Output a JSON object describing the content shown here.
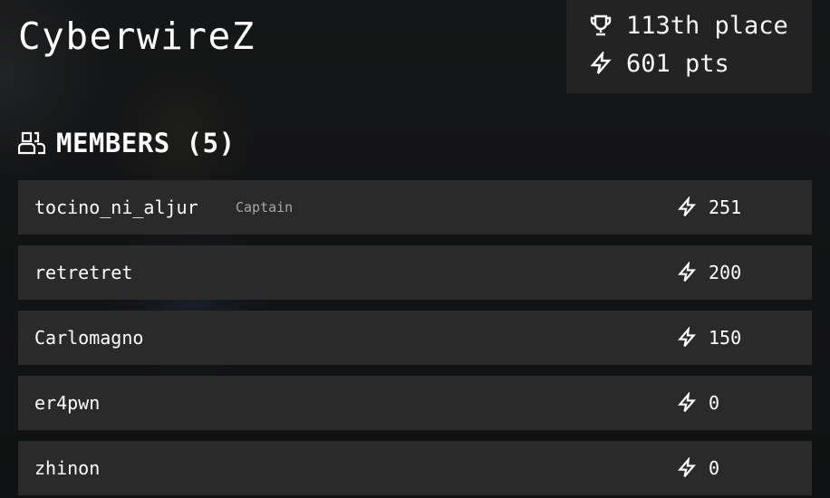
{
  "team": {
    "name": "CyberwireZ"
  },
  "stats": {
    "place": "113th place",
    "place_icon": "trophy-icon",
    "points": "601 pts",
    "points_icon": "lightning-icon"
  },
  "members": {
    "heading": "MEMBERS (5)",
    "heading_icon": "users-icon",
    "list": [
      {
        "name": "tocino_ni_aljur",
        "role": "Captain",
        "score": "251"
      },
      {
        "name": "retretret",
        "role": "",
        "score": "200"
      },
      {
        "name": "Carlomagno",
        "role": "",
        "score": "150"
      },
      {
        "name": "er4pwn",
        "role": "",
        "score": "0"
      },
      {
        "name": "zhinon",
        "role": "",
        "score": "0"
      }
    ]
  },
  "colors": {
    "background": "#111213",
    "panel": "#232323",
    "row": "#2a2a2a",
    "text": "#ffffff",
    "muted": "#a6a6a6"
  }
}
